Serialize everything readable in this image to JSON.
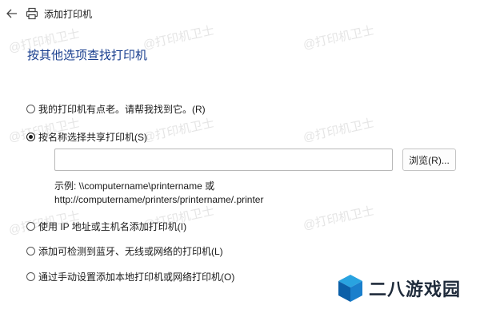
{
  "window": {
    "title": "添加打印机",
    "back_icon": "back-arrow-icon",
    "printer_icon": "printer-icon"
  },
  "heading": "按其他选项查找打印机",
  "options": [
    {
      "label": "我的打印机有点老。请帮我找到它。(R)",
      "checked": false
    },
    {
      "label": "按名称选择共享打印机(S)",
      "checked": true
    },
    {
      "label": "使用 IP 地址或主机名添加打印机(I)",
      "checked": false
    },
    {
      "label": "添加可检测到蓝牙、无线或网络的打印机(L)",
      "checked": false
    },
    {
      "label": "通过手动设置添加本地打印机或网络打印机(O)",
      "checked": false
    }
  ],
  "printer_name_input": {
    "value": "",
    "placeholder": ""
  },
  "browse_button": "浏览(R)...",
  "example": {
    "line1": "示例: \\\\computername\\printername 或",
    "line2": "http://computername/printers/printername/.printer"
  },
  "watermark": "@打印机卫士",
  "site_logo": {
    "text": "二八游戏园",
    "colors": {
      "light": "#29a3e0",
      "dark": "#0b5fa8"
    }
  }
}
